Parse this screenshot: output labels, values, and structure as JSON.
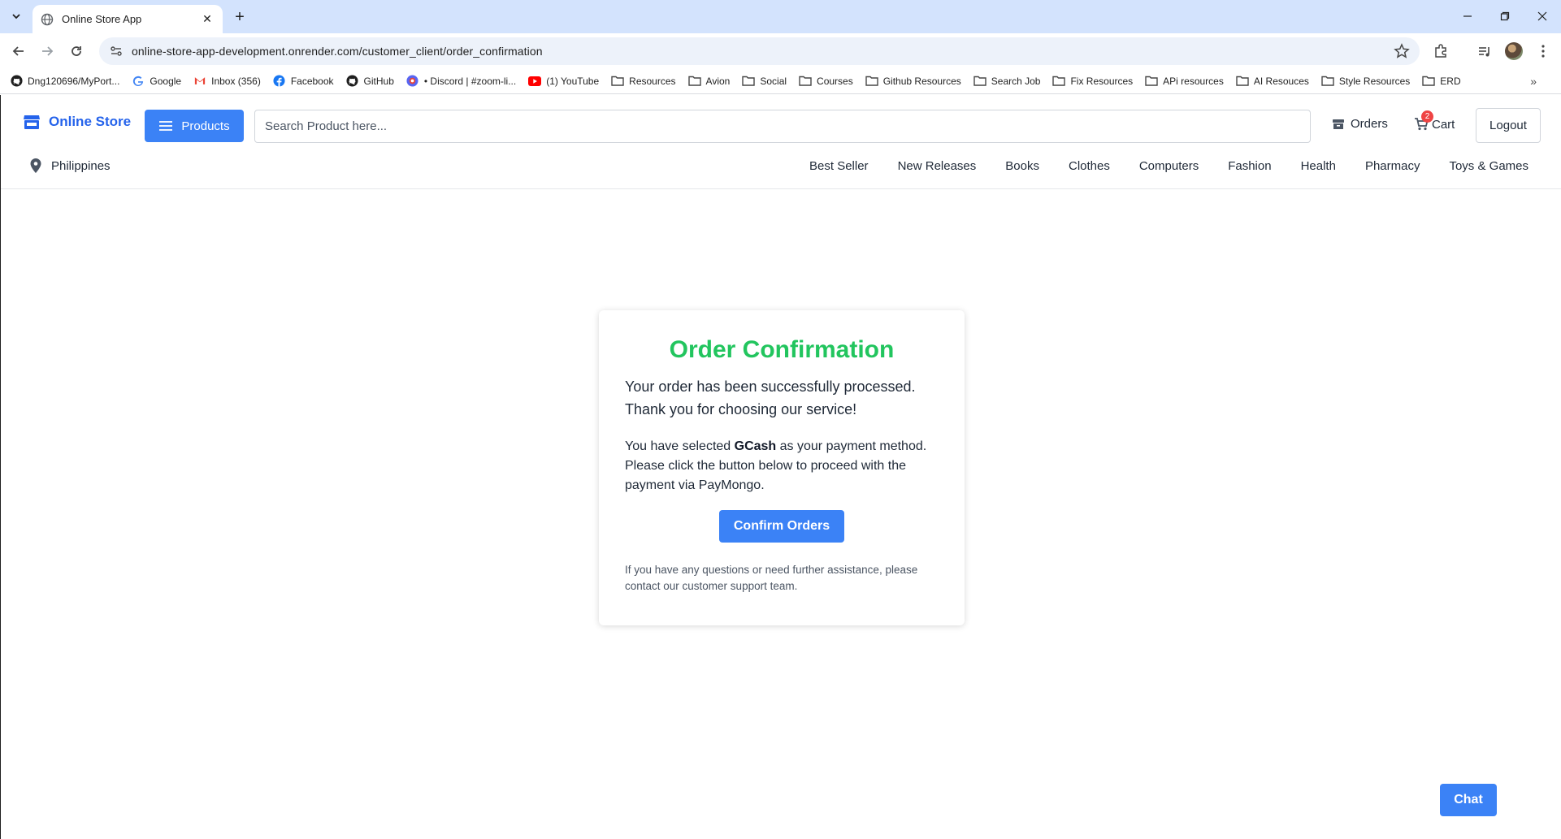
{
  "browser": {
    "tab_title": "Online Store App",
    "url": "online-store-app-development.onrender.com/customer_client/order_confirmation",
    "bookmarks": [
      {
        "label": "Dng120696/MyPort...",
        "icon": "github-icon"
      },
      {
        "label": "Google",
        "icon": "google-icon"
      },
      {
        "label": "Inbox (356)",
        "icon": "gmail-icon"
      },
      {
        "label": "Facebook",
        "icon": "facebook-icon"
      },
      {
        "label": "GitHub",
        "icon": "github-icon"
      },
      {
        "label": "• Discord | #zoom-li...",
        "icon": "discord-icon"
      },
      {
        "label": "(1) YouTube",
        "icon": "youtube-icon"
      },
      {
        "label": "Resources",
        "icon": "folder-icon"
      },
      {
        "label": "Avion",
        "icon": "folder-icon"
      },
      {
        "label": "Social",
        "icon": "folder-icon"
      },
      {
        "label": "Courses",
        "icon": "folder-icon"
      },
      {
        "label": "Github Resources",
        "icon": "folder-icon"
      },
      {
        "label": "Search Job",
        "icon": "folder-icon"
      },
      {
        "label": "Fix Resources",
        "icon": "folder-icon"
      },
      {
        "label": "APi resources",
        "icon": "folder-icon"
      },
      {
        "label": "AI Resouces",
        "icon": "folder-icon"
      },
      {
        "label": "Style Resources",
        "icon": "folder-icon"
      },
      {
        "label": "ERD",
        "icon": "folder-icon"
      }
    ],
    "more_bookmarks": "»"
  },
  "header": {
    "logo_text": "Online Store",
    "products_label": "Products",
    "search_placeholder": "Search Product here...",
    "orders_label": "Orders",
    "cart_label": "Cart",
    "cart_count": "2",
    "logout_label": "Logout",
    "location": "Philippines",
    "categories": [
      "Best Seller",
      "New Releases",
      "Books",
      "Clothes",
      "Computers",
      "Fashion",
      "Health",
      "Pharmacy",
      "Toys & Games"
    ]
  },
  "confirmation": {
    "title": "Order Confirmation",
    "lead": "Your order has been successfully processed. Thank you for choosing our service!",
    "body_before": "You have selected ",
    "payment_method": "GCash",
    "body_after": " as your payment method. Please click the button below to proceed with the payment via PayMongo.",
    "button_label": "Confirm Orders",
    "note": "If you have any questions or need further assistance, please contact our customer support team."
  },
  "chat": {
    "label": "Chat"
  },
  "colors": {
    "primary": "#3b82f6",
    "brand": "#2563eb",
    "success": "#22c55e",
    "badge": "#ef4444",
    "tabstrip": "#d3e3fd"
  }
}
